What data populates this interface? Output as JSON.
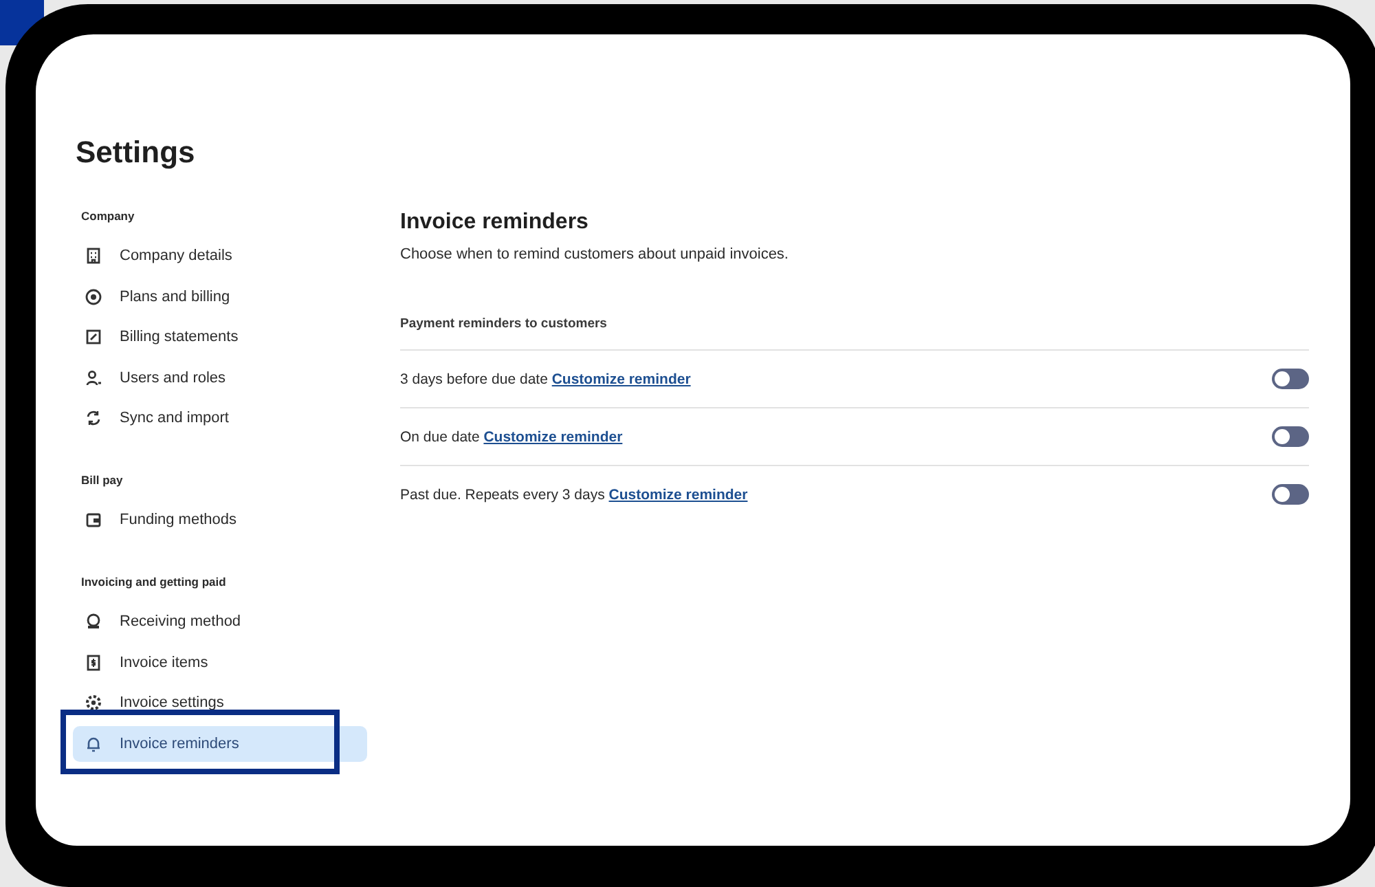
{
  "page": {
    "title": "Settings"
  },
  "sidebar": {
    "sections": [
      {
        "heading": "Company",
        "items": [
          {
            "label": "Company details",
            "selected": false
          },
          {
            "label": "Plans and billing",
            "selected": false
          },
          {
            "label": "Billing statements",
            "selected": false
          },
          {
            "label": "Users and roles",
            "selected": false
          },
          {
            "label": "Sync and import",
            "selected": false
          }
        ]
      },
      {
        "heading": "Bill pay",
        "items": [
          {
            "label": "Funding methods",
            "selected": false
          }
        ]
      },
      {
        "heading": "Invoicing and getting paid",
        "items": [
          {
            "label": "Receiving method",
            "selected": false
          },
          {
            "label": "Invoice items",
            "selected": false
          },
          {
            "label": "Invoice settings",
            "selected": false
          },
          {
            "label": "Invoice reminders",
            "selected": true
          }
        ]
      }
    ]
  },
  "main": {
    "title": "Invoice reminders",
    "subtitle": "Choose when to remind customers about unpaid invoices.",
    "section_heading": "Payment reminders to customers",
    "reminders": [
      {
        "text": "3 days before due date",
        "link": "Customize reminder",
        "on": false
      },
      {
        "text": "On due date",
        "link": "Customize reminder",
        "on": false
      },
      {
        "text": "Past due. Repeats every 3 days",
        "link": "Customize reminder",
        "on": false
      }
    ]
  }
}
